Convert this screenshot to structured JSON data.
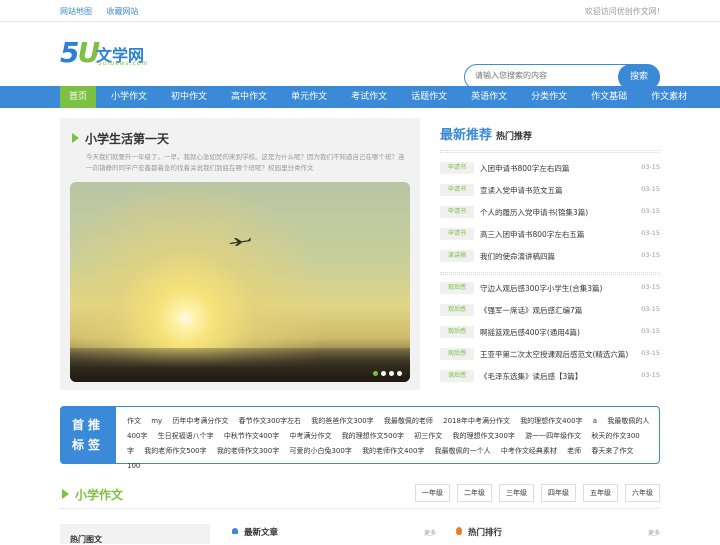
{
  "topbar": {
    "links": [
      "网站地图",
      "收藏网站"
    ],
    "welcome": "欢迎访问优创作文网!"
  },
  "logo": {
    "five": "5",
    "u": "U",
    "cn": "文学网",
    "sub": "5uluews.com"
  },
  "search": {
    "placeholder": "请输入您搜索的内容",
    "button": "搜索"
  },
  "nav": [
    "首页",
    "小学作文",
    "初中作文",
    "高中作文",
    "单元作文",
    "考试作文",
    "话题作文",
    "英语作文",
    "分类作文",
    "作文基础",
    "作文素材"
  ],
  "feature": {
    "title": "小学生活第一天",
    "desc": "今天我们就要升一年级了。一早，我就心急如焚的来到学校。这是为什么呢？因为我们不知道自己在哪个班？连一向镇静的同学户宏鑫都着急的找着关说我们到底在哪个班呢？校园里分类作文"
  },
  "recommend": {
    "title": "最新推荐",
    "subtitle": "热门推荐",
    "group1": [
      {
        "tag": "申请书",
        "text": "入团申请书800字左右四篇",
        "date": "03-15"
      },
      {
        "tag": "申请书",
        "text": "宣读入党申请书范文五篇",
        "date": "03-15"
      },
      {
        "tag": "申请书",
        "text": "个人的履历入党申请书(锦集3篇)",
        "date": "03-15"
      },
      {
        "tag": "申请书",
        "text": "高三入团申请书800字左右五篇",
        "date": "03-15"
      },
      {
        "tag": "演讲稿",
        "text": "我们的使命演讲稿四篇",
        "date": "03-15"
      }
    ],
    "group2": [
      {
        "tag": "观后感",
        "text": "守边人观后感300字小学生(合集3篇)",
        "date": "03-15"
      },
      {
        "tag": "观后感",
        "text": "《强军一席话》观后感汇编7篇",
        "date": "03-15"
      },
      {
        "tag": "观后感",
        "text": "啊摇篮观后感400字(通用4篇)",
        "date": "03-15"
      },
      {
        "tag": "观后感",
        "text": "王亚平第二次太空授课观后感范文(精选六篇)",
        "date": "03-15"
      },
      {
        "tag": "读后感",
        "text": "《毛泽东选集》读后感【3篇】",
        "date": "03-15"
      }
    ]
  },
  "tags": {
    "label1": "首推",
    "label2": "标签",
    "words": [
      "作文",
      "my",
      "历年中考满分作文",
      "春节作文300字左右",
      "我的爸爸作文300字",
      "我最敬佩的老师",
      "2018年中考满分作文",
      "我的理想作文400字",
      "a",
      "我最敬佩的人400字",
      "生日祝福语八个字",
      "中秋节作文400字",
      "中考满分作文",
      "我的理想作文500字",
      "初三作文",
      "我的理想作文300字",
      "游一一四年级作文",
      "秋天的作文300字",
      "我的老师作文500字",
      "我的老师作文300字",
      "可爱的小白兔300字",
      "我的老师作文400字",
      "我最敬佩的一个人",
      "中考作文经典素材",
      "老师",
      "春天来了作文100"
    ]
  },
  "section": {
    "title": "小学作文",
    "grades": [
      "一年级",
      "二年级",
      "三年级",
      "四年级",
      "五年级",
      "六年级"
    ]
  },
  "columns": {
    "a_title": "热门图文",
    "b_title": "最新文章",
    "c_title": "热门排行",
    "more": "更多"
  }
}
